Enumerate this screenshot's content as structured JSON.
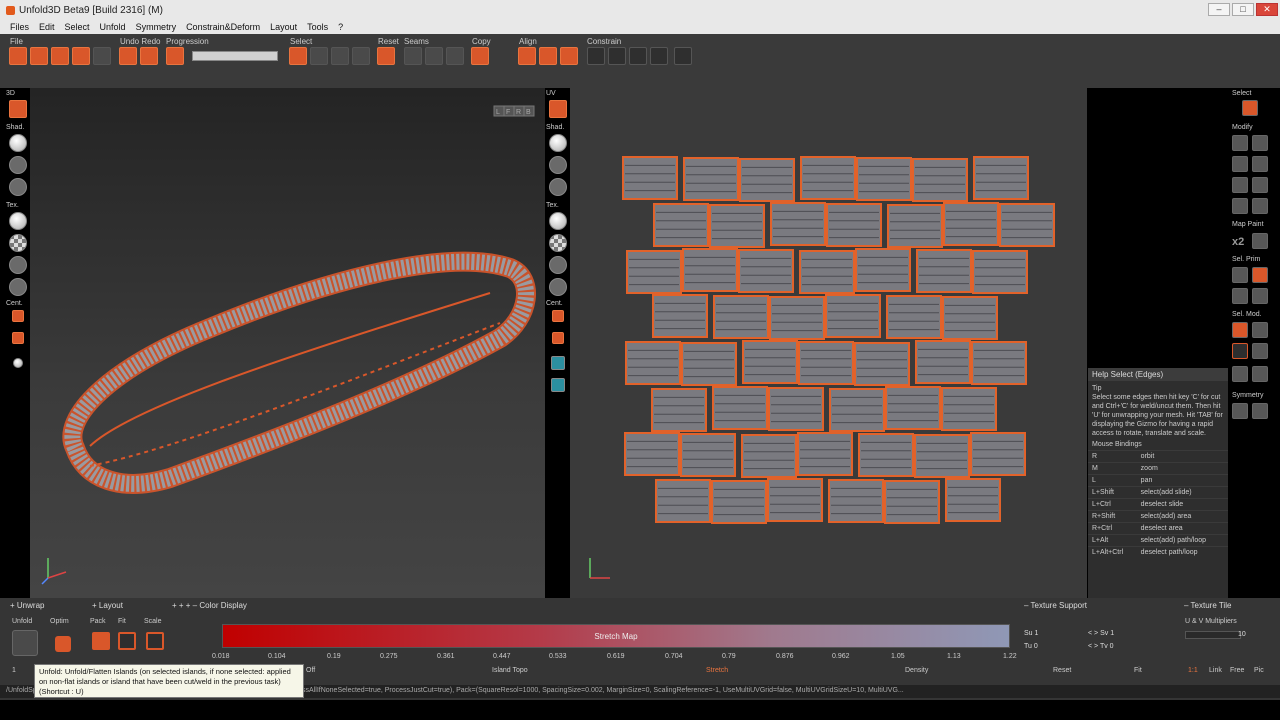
{
  "window": {
    "title": "Unfold3D Beta9 [Build 2316] (M)",
    "minimize": "–",
    "maximize": "□",
    "close": "✕"
  },
  "menu": [
    "Files",
    "Edit",
    "Select",
    "Unfold",
    "Symmetry",
    "Constrain&Deform",
    "Layout",
    "Tools",
    "?"
  ],
  "toolbar_groups": [
    "File",
    "Undo Redo",
    "Progression",
    "Select",
    "Reset",
    "Seams",
    "Copy",
    "Align",
    "Constrain"
  ],
  "left_sidebar": {
    "view": "3D",
    "shad": "Shad.",
    "tex": "Tex.",
    "cent": "Cent."
  },
  "uv_sidebar": {
    "view": "UV",
    "shad": "Shad.",
    "tex": "Tex.",
    "cent": "Cent."
  },
  "viewcube": [
    "L",
    "F",
    "R",
    "B"
  ],
  "right_panel": {
    "select": "Select",
    "modify": "Modify",
    "map_paint": "Map Paint",
    "x2": "x2",
    "sel_prim": "Sel. Prim",
    "sel_mod": "Sel. Mod.",
    "symmetry": "Symmetry"
  },
  "help": {
    "title": "Help Select (Edges)",
    "tip_label": "Tip",
    "tip": "Select some edges then hit key 'C' for cut and Ctrl+'C' for weld/uncut them. Then hit 'U' for unwrapping your mesh. Hit 'TAB' for displaying the Gizmo for having a rapid access to rotate, translate and scale.",
    "mouse_label": "Mouse Bindings",
    "bindings": [
      [
        "R",
        "orbit"
      ],
      [
        "M",
        "zoom"
      ],
      [
        "L",
        "pan"
      ],
      [
        "L+Shift",
        "select(add slide)"
      ],
      [
        "L+Ctrl",
        "deselect slide"
      ],
      [
        "R+Shift",
        "select(add) area"
      ],
      [
        "R+Ctrl",
        "deselect area"
      ],
      [
        "L+Alt",
        "select(add) path/loop"
      ],
      [
        "L+Alt+Ctrl",
        "deselect path/loop"
      ]
    ]
  },
  "bottom": {
    "unwrap": "Unwrap",
    "layout": "Layout",
    "color_display": "Color Display",
    "texture_support": "Texture Support",
    "texture_tile": "Texture Tile",
    "unfold": "Unfold",
    "optim": "Optim",
    "pack": "Pack",
    "fit": "Fit",
    "scale": "Scale",
    "stretch_map": "Stretch Map",
    "ticks": [
      "0.018",
      "0.104",
      "0.19",
      "0.275",
      "0.361",
      "0.447",
      "0.533",
      "0.619",
      "0.704",
      "0.79",
      "0.876",
      "0.962",
      "1.05",
      "1.13",
      "1.22"
    ],
    "off": "Off",
    "island_topo": "Island Topo",
    "stretch": "Stretch",
    "density": "Density",
    "reset": "Reset",
    "fit2": "Fit",
    "ratio": "1:1",
    "link": "Link",
    "free": "Free",
    "pic": "Pic",
    "su": "Su 1",
    "tu": "Tu 0",
    "sv": "Sv 1",
    "tv": "Tv 0",
    "uv_mult": "U & V Multipliers",
    "mult_val": "10",
    "one": "1"
  },
  "statusbar": "/UnfoldSpace=0.002, FinMapName='Pin', ProcessNonFlats=true, ProcessSelection=true, ProcessAllIfNoneSelected=true, ProcessJustCut=true), Pack=(SquareResol=1000, SpacingSize=0.002, MarginSize=0, ScalingReference=-1, UseMultiUVGrid=false, MultiUVGridSizeU=10, MultiUVG...",
  "tooltip": "Unfold: Unfold/Flatten Islands (on selected islands, if none selected: applied on non-flat islands or island that have been cut/weld in the previous task) (Shortcut : U)",
  "colors": {
    "accent": "#d9572a",
    "bg": "#3a3a3a",
    "stretch_start": "#c00000",
    "stretch_end": "#8f98b6"
  }
}
